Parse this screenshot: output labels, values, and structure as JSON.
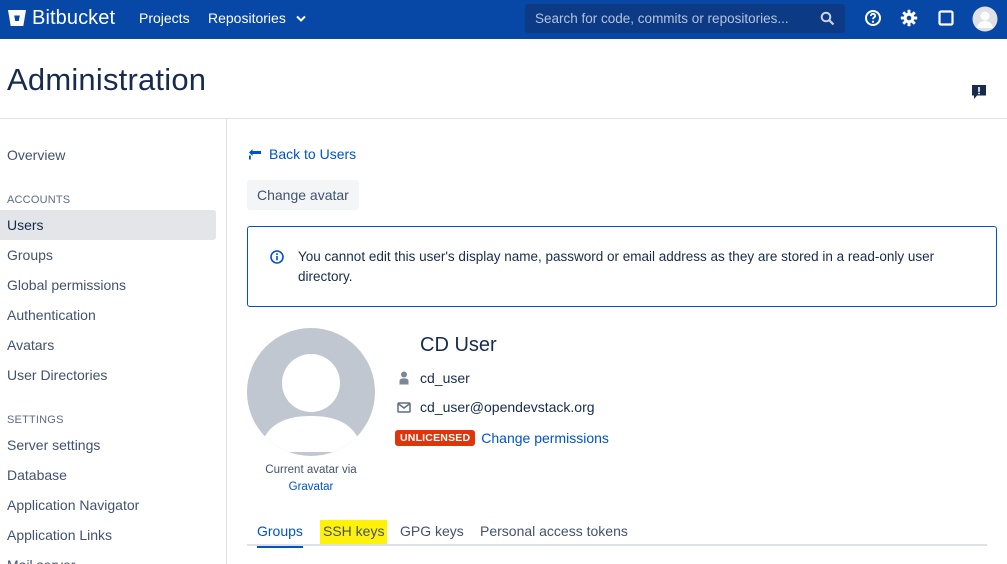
{
  "app": {
    "name": "Bitbucket",
    "nav": {
      "projects": "Projects",
      "repositories": "Repositories"
    },
    "search": {
      "placeholder": "Search for code, commits or repositories..."
    },
    "colors": {
      "topbar": "#0747a6",
      "link": "#0052cc",
      "badge": "#de350b",
      "highlight": "#fff10a"
    }
  },
  "page": {
    "title": "Administration"
  },
  "sidebar": {
    "overview": "Overview",
    "accounts_heading": "ACCOUNTS",
    "accounts": [
      "Users",
      "Groups",
      "Global permissions",
      "Authentication",
      "Avatars",
      "User Directories"
    ],
    "settings_heading": "SETTINGS",
    "settings": [
      "Server settings",
      "Database",
      "Application Navigator",
      "Application Links",
      "Mail server"
    ],
    "active": "Users"
  },
  "main": {
    "back_link": "Back to Users",
    "change_avatar": "Change avatar",
    "info_message": "You cannot edit this user's display name, password or email address as they are stored in a read-only user directory.",
    "avatar_caption": "Current avatar via",
    "avatar_source": "Gravatar",
    "user": {
      "display_name": "CD User",
      "username": "cd_user",
      "email": "cd_user@opendevstack.org",
      "license_badge": "UNLICENSED",
      "change_permissions": "Change permissions"
    },
    "tabs": [
      "Groups",
      "SSH keys",
      "GPG keys",
      "Personal access tokens"
    ],
    "active_tab": "Groups",
    "highlighted_tab": "SSH keys"
  }
}
